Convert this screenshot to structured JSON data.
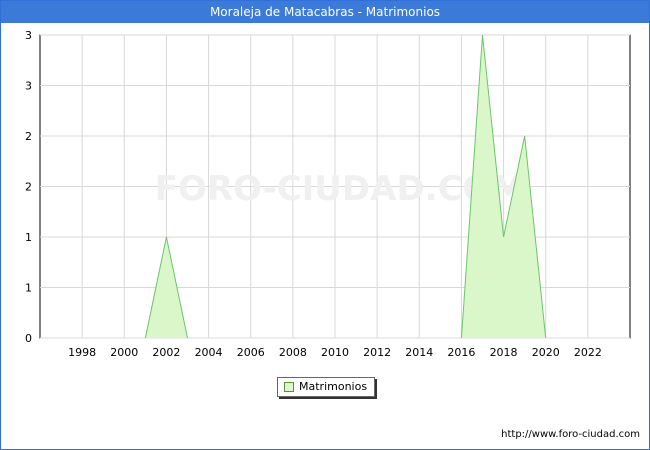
{
  "page": {
    "watermark": "FORO-CIUDAD.COM",
    "url": "http://www.foro-ciudad.com"
  },
  "chart_data": {
    "type": "area",
    "title": "Moraleja de Matacabras - Matrimonios",
    "xlabel": "",
    "ylabel": "",
    "x_ticks": [
      1998,
      2000,
      2002,
      2004,
      2006,
      2008,
      2010,
      2012,
      2014,
      2016,
      2018,
      2020,
      2022
    ],
    "y_ticks": [
      0,
      1,
      1,
      2,
      2,
      3,
      3
    ],
    "xlim": [
      1996,
      2024
    ],
    "ylim": [
      0,
      3
    ],
    "grid": true,
    "legend_position": "bottom",
    "series": [
      {
        "name": "Matrimonios",
        "color": "#d9f7c9",
        "stroke": "#6cc46c",
        "x": [
          2001,
          2002,
          2003,
          2016,
          2017,
          2018,
          2019,
          2020
        ],
        "values": [
          0,
          1,
          0,
          0,
          3,
          1,
          2,
          0
        ]
      }
    ]
  }
}
